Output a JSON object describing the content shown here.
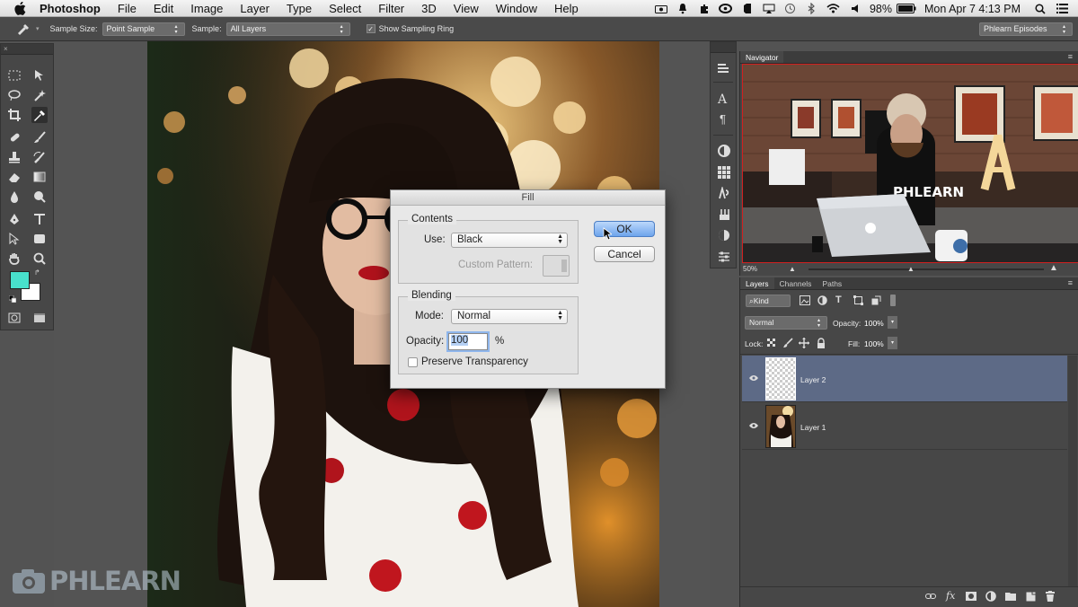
{
  "menubar": {
    "items": [
      "Photoshop",
      "File",
      "Edit",
      "Image",
      "Layer",
      "Type",
      "Select",
      "Filter",
      "3D",
      "View",
      "Window",
      "Help"
    ],
    "battery": "98%",
    "datetime": "Mon Apr 7  4:13 PM"
  },
  "options": {
    "sample_size_label": "Sample Size:",
    "sample_size_value": "Point Sample",
    "sample_label": "Sample:",
    "sample_value": "All Layers",
    "show_ring_label": "Show Sampling Ring",
    "workspace": "Phlearn Episodes"
  },
  "colors": {
    "foreground": "#48e0cc",
    "background": "#ffffff",
    "selection": "#5d6a86",
    "accent_button": "#6ea4ec"
  },
  "navigator": {
    "tab": "Navigator",
    "zoom": "50%"
  },
  "layers_panel": {
    "tabs": [
      "Layers",
      "Channels",
      "Paths"
    ],
    "filter": "Kind",
    "blend_mode": "Normal",
    "opacity_label": "Opacity:",
    "opacity": "100%",
    "lock_label": "Lock:",
    "fill_label": "Fill:",
    "fill": "100%",
    "layers": [
      {
        "name": "Layer 2",
        "selected": true
      },
      {
        "name": "Layer 1",
        "selected": false
      }
    ]
  },
  "dialog": {
    "title": "Fill",
    "contents_label": "Contents",
    "use_label": "Use:",
    "use_value": "Black",
    "custom_pattern_label": "Custom Pattern:",
    "blending_label": "Blending",
    "mode_label": "Mode:",
    "mode_value": "Normal",
    "opacity_label": "Opacity:",
    "opacity_value": "100",
    "percent": "%",
    "preserve_label": "Preserve Transparency",
    "ok": "OK",
    "cancel": "Cancel"
  },
  "watermark": "PHLEARN"
}
